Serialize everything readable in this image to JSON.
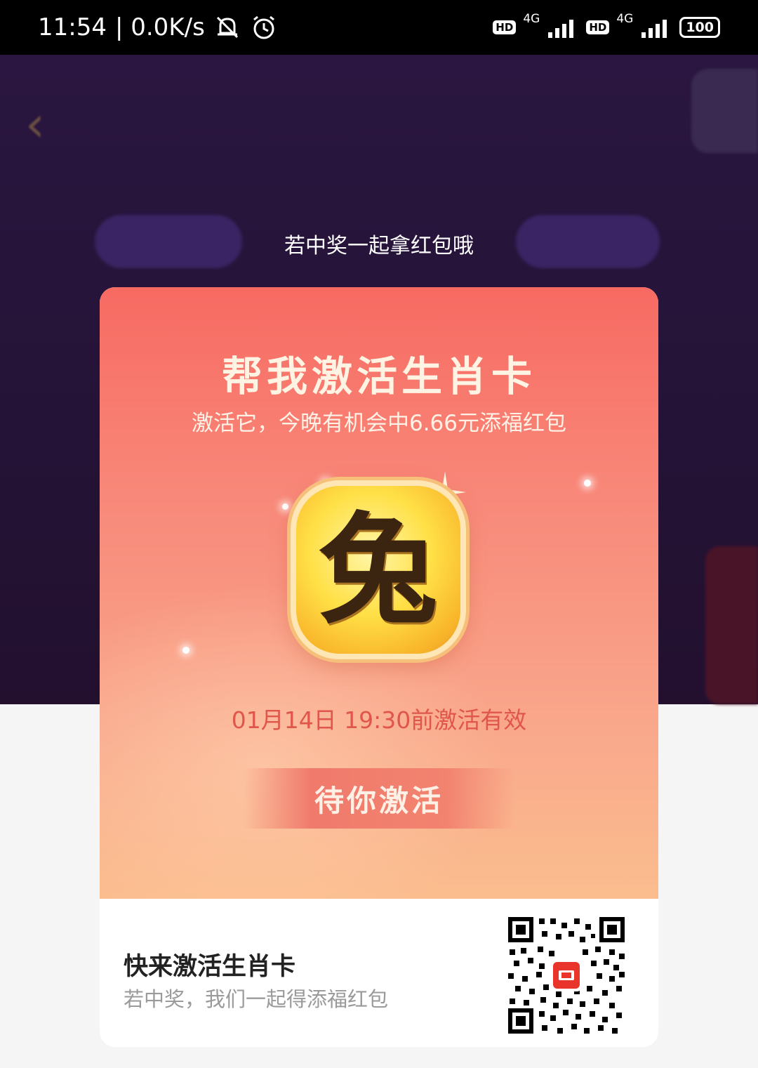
{
  "status_bar": {
    "time": "11:54",
    "net_speed": "| 0.0K/s",
    "sim1_badge": "HD",
    "sim1_net": "4G",
    "sim2_badge": "HD",
    "sim2_net": "4G",
    "battery": "100",
    "icons": [
      "mute-bell-icon",
      "alarm-icon",
      "signal-icon",
      "battery-icon"
    ]
  },
  "overlay": {
    "hint": "若中奖一起拿红包哦"
  },
  "card": {
    "title": "帮我激活生肖卡",
    "subtitle": "激活它，今晚有机会中6.66元添福红包",
    "zodiac_char": "兔",
    "expire_text": "01月14日 19:30前激活有效",
    "button_label": "待你激活",
    "share_title": "快来激活生肖卡",
    "share_subtitle": "若中奖，我们一起得添福红包"
  },
  "colors": {
    "card_top": "#f76a62",
    "card_bottom": "#fbbd8e",
    "expire_text": "#e0564a",
    "background": "#2a1640"
  }
}
